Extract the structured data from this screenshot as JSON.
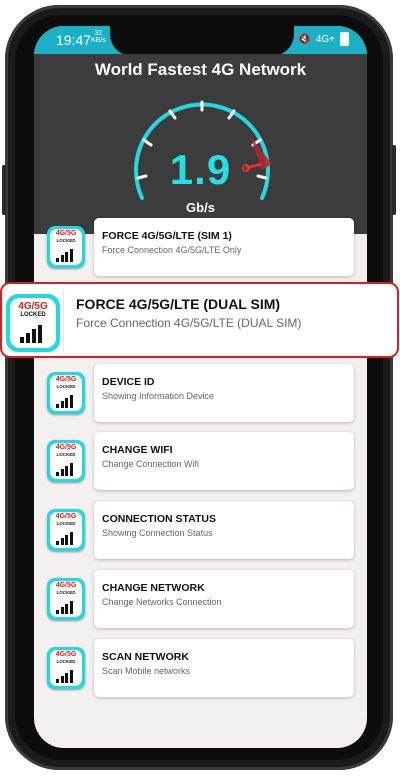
{
  "status": {
    "time": "19:47",
    "kb_top": "32",
    "kb_bottom": "KB/s",
    "signal": "4G+",
    "battery": "▮"
  },
  "header": {
    "title": "World Fastest 4G Network",
    "speed_value": "1.9",
    "speed_unit": "Gb/s",
    "gauge_level": 0.9
  },
  "icon": {
    "name": "4g-5g-locked-icon",
    "line1": "4G/5G",
    "line2": "LOCKED"
  },
  "items": [
    {
      "title": "FORCE 4G/5G/LTE (SIM 1)",
      "subtitle": "Force Connection 4G/5G/LTE Only"
    },
    {
      "title": "FORCE 4G/5G/LTE (DUAL SIM)",
      "subtitle": "Force Connection 4G/5G/LTE (DUAL SIM)"
    },
    {
      "title": "DEVICE ID",
      "subtitle": "Showing Information Device"
    },
    {
      "title": "CHANGE WIFI",
      "subtitle": "Change Connection Wifi"
    },
    {
      "title": "CONNECTION STATUS",
      "subtitle": "Showing Connection Status"
    },
    {
      "title": "CHANGE NETWORK",
      "subtitle": "Change Networks Connection"
    },
    {
      "title": "SCAN NETWORK",
      "subtitle": "Scan Mobile networks"
    }
  ],
  "colors": {
    "accent": "#22d9df",
    "header_bg": "#3c3c3c",
    "status_bg": "#1bb0c3",
    "highlight_border": "#d41f2a"
  }
}
